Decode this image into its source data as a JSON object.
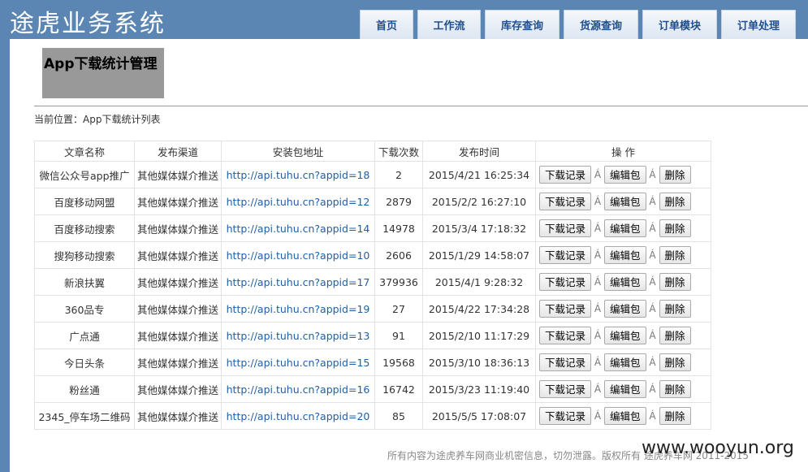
{
  "app": {
    "title": "途虎业务系统"
  },
  "nav": {
    "tabs": [
      "首页",
      "工作流",
      "库存查询",
      "货源查询",
      "订单模块",
      "订单处理"
    ]
  },
  "page": {
    "heading": "App下载统计管理",
    "breadcrumb": "当前位置：App下载统计列表"
  },
  "table": {
    "headers": [
      "文章名称",
      "发布渠道",
      "安装包地址",
      "下载次数",
      "发布时间",
      "操 作"
    ],
    "actions": {
      "records": "下载记录",
      "edit": "编辑包",
      "delete": "删除",
      "separator": "Á"
    },
    "rows": [
      {
        "name": "微信公众号app推广",
        "channel": "其他媒体媒介推送",
        "url": "http://api.tuhu.cn?appid=18",
        "downloads": "2",
        "time": "2015/4/21 16:25:34"
      },
      {
        "name": "百度移动网盟",
        "channel": "其他媒体媒介推送",
        "url": "http://api.tuhu.cn?appid=12",
        "downloads": "2879",
        "time": "2015/2/2 16:27:10"
      },
      {
        "name": "百度移动搜索",
        "channel": "其他媒体媒介推送",
        "url": "http://api.tuhu.cn?appid=14",
        "downloads": "14978",
        "time": "2015/3/4 17:18:32"
      },
      {
        "name": "搜狗移动搜索",
        "channel": "其他媒体媒介推送",
        "url": "http://api.tuhu.cn?appid=10",
        "downloads": "2606",
        "time": "2015/1/29 14:58:07"
      },
      {
        "name": "新浪扶翼",
        "channel": "其他媒体媒介推送",
        "url": "http://api.tuhu.cn?appid=17",
        "downloads": "379936",
        "time": "2015/4/1 9:28:32"
      },
      {
        "name": "360品专",
        "channel": "其他媒体媒介推送",
        "url": "http://api.tuhu.cn?appid=19",
        "downloads": "27",
        "time": "2015/4/22 17:34:28"
      },
      {
        "name": "广点通",
        "channel": "其他媒体媒介推送",
        "url": "http://api.tuhu.cn?appid=13",
        "downloads": "91",
        "time": "2015/2/10 11:17:29"
      },
      {
        "name": "今日头条",
        "channel": "其他媒体媒介推送",
        "url": "http://api.tuhu.cn?appid=15",
        "downloads": "19568",
        "time": "2015/3/10 18:36:13"
      },
      {
        "name": "粉丝通",
        "channel": "其他媒体媒介推送",
        "url": "http://api.tuhu.cn?appid=16",
        "downloads": "16742",
        "time": "2015/3/23 11:19:40"
      },
      {
        "name": "2345_停车场二维码",
        "channel": "其他媒体媒介推送",
        "url": "http://api.tuhu.cn?appid=20",
        "downloads": "85",
        "time": "2015/5/5 17:08:07"
      }
    ]
  },
  "footer": {
    "text": "所有内容为途虎养车网商业机密信息，切勿泄露。版权所有 途虎养车网 2011-2015"
  },
  "watermark": "www.wooyun.org"
}
